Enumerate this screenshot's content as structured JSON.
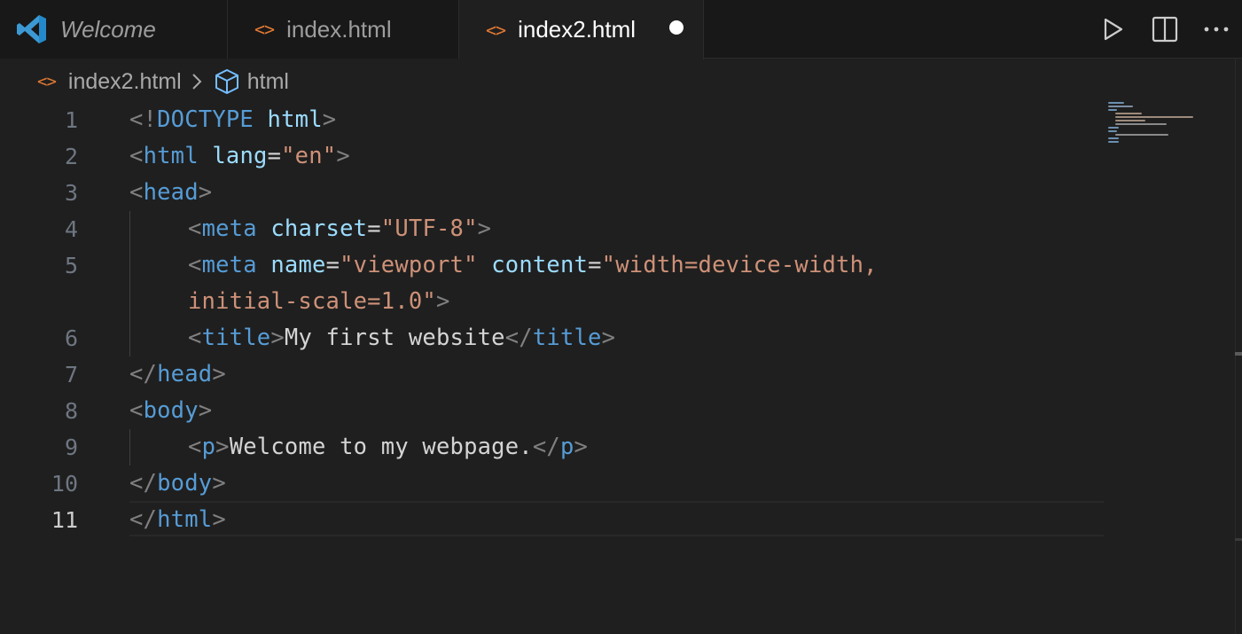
{
  "tabs": [
    {
      "label": "Welcome",
      "icon": "vscode-logo-icon",
      "active": false
    },
    {
      "label": "index.html",
      "icon": "html-file-icon",
      "active": false
    },
    {
      "label": "index2.html",
      "icon": "html-file-icon",
      "active": true,
      "dirty": true
    }
  ],
  "tab_actions": [
    "run-icon",
    "split-editor-icon",
    "more-actions-icon"
  ],
  "breadcrumb": {
    "file": "index2.html",
    "symbol": "html",
    "file_icon_glyph": "<>"
  },
  "editor": {
    "line_numbers": [
      "1",
      "2",
      "3",
      "4",
      "5",
      "",
      "6",
      "7",
      "8",
      "9",
      "10",
      "11"
    ],
    "current_line": "11",
    "lines": {
      "l1": {
        "a": "<!",
        "b": "DOCTYPE",
        "c": " ",
        "d": "html",
        "e": ">"
      },
      "l2": {
        "a": "<",
        "b": "html",
        "c": " ",
        "d": "lang",
        "e": "=",
        "f": "\"en\"",
        "g": ">"
      },
      "l3": {
        "a": "<",
        "b": "head",
        "c": ">"
      },
      "l4": {
        "a": "<",
        "b": "meta",
        "c": " ",
        "d": "charset",
        "e": "=",
        "f": "\"UTF-8\"",
        "g": ">"
      },
      "l5": {
        "a": "<",
        "b": "meta",
        "c": " ",
        "d": "name",
        "e": "=",
        "f": "\"viewport\"",
        "g": " ",
        "h": "content",
        "i": "=",
        "j": "\"width=device-width,"
      },
      "l5b": {
        "a": "initial-scale=1.0\"",
        "b": ">"
      },
      "l6": {
        "a": "<",
        "b": "title",
        "c": ">",
        "d": "My first website",
        "e": "</",
        "f": "title",
        "g": ">"
      },
      "l7": {
        "a": "</",
        "b": "head",
        "c": ">"
      },
      "l8": {
        "a": "<",
        "b": "body",
        "c": ">"
      },
      "l9": {
        "a": "<",
        "b": "p",
        "c": ">",
        "d": "Welcome to my webpage.",
        "e": "</",
        "f": "p",
        "g": ">"
      },
      "l10": {
        "a": "</",
        "b": "body",
        "c": ">"
      },
      "l11": {
        "a": "</",
        "b": "html",
        "c": ">"
      }
    }
  },
  "colors": {
    "tag": "#569cd6",
    "attribute": "#9cdcfe",
    "string": "#ce9178",
    "punctuation": "#808080",
    "text": "#d4d4d4",
    "file_icon": "#e37933",
    "vscode_blue": "#3c99d4"
  }
}
